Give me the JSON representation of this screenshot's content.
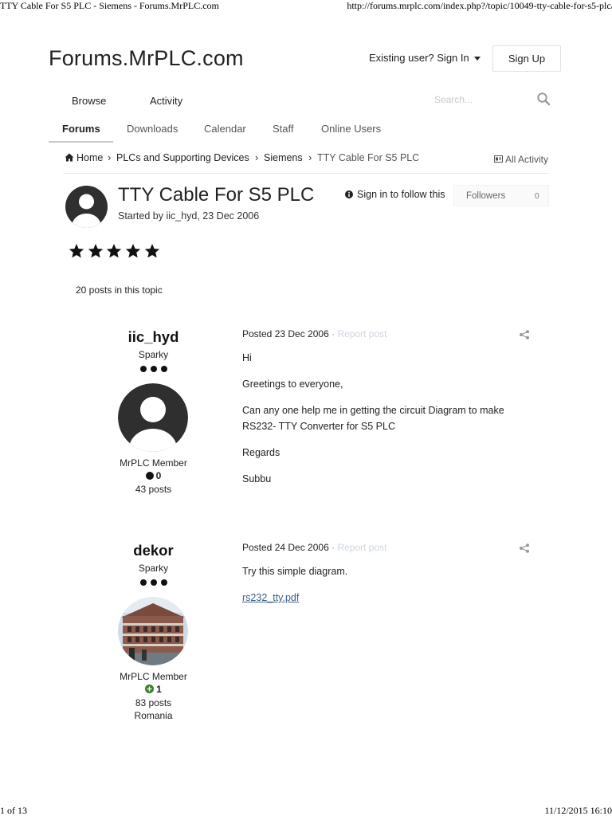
{
  "print": {
    "header_left": "TTY Cable For S5 PLC - Siemens - Forums.MrPLC.com",
    "header_right": "http://forums.mrplc.com/index.php?/topic/10049-tty-cable-for-s5-plc/",
    "footer_left": "1 of 13",
    "footer_right": "11/12/2015 16:10"
  },
  "site": {
    "title": "Forums.MrPLC.com"
  },
  "header": {
    "signin_label": "Existing user? Sign In",
    "signup_label": "Sign Up"
  },
  "primary_nav": [
    {
      "label": "Browse"
    },
    {
      "label": "Activity"
    }
  ],
  "search": {
    "placeholder": "Search..."
  },
  "secondary_nav": [
    {
      "label": "Forums",
      "active": true
    },
    {
      "label": "Downloads"
    },
    {
      "label": "Calendar"
    },
    {
      "label": "Staff"
    },
    {
      "label": "Online Users"
    }
  ],
  "breadcrumb": [
    "Home",
    "PLCs and Supporting Devices",
    "Siemens",
    "TTY Cable For S5 PLC"
  ],
  "all_activity_label": "All Activity",
  "topic": {
    "title": "TTY Cable For S5 PLC",
    "started_by": "Started by iic_hyd, 23 Dec 2006",
    "follow_label": "Sign in to follow this",
    "followers_label": "Followers",
    "followers_count": "0",
    "rating_stars": 5,
    "posts_in_topic": "20 posts in this topic"
  },
  "posts": [
    {
      "author": "iic_hyd",
      "rank": "Sparky",
      "group": "MrPLC Member",
      "reputation": "0",
      "post_count": "43 posts",
      "location": "",
      "posted": "Posted 23 Dec 2006",
      "report_label": "Report post",
      "body": [
        "Hi",
        "Greetings to everyone,",
        "Can any one help me in getting the circuit Diagram to make RS232- TTY Converter for S5 PLC",
        "Regards",
        "Subbu"
      ],
      "attachment": ""
    },
    {
      "author": "dekor",
      "rank": "Sparky",
      "group": "MrPLC Member",
      "reputation": "1",
      "post_count": "83 posts",
      "location": "Romania",
      "posted": "Posted 24 Dec 2006",
      "report_label": "Report post",
      "body": [
        "Try this simple diagram."
      ],
      "attachment": "rs232_tty.pdf"
    }
  ],
  "colors": {
    "text": "#222222",
    "muted": "#555555",
    "report_link": "#cfd6dd",
    "attachment_link": "#3b5f86",
    "reputation_positive": "#3a7d2c"
  },
  "icons": [
    "home-icon",
    "chevron-right-icon",
    "search-icon",
    "caret-down-icon",
    "info-icon",
    "activity-icon",
    "star-icon",
    "share-icon",
    "plus-circle-icon",
    "avatar-placeholder-icon"
  ]
}
